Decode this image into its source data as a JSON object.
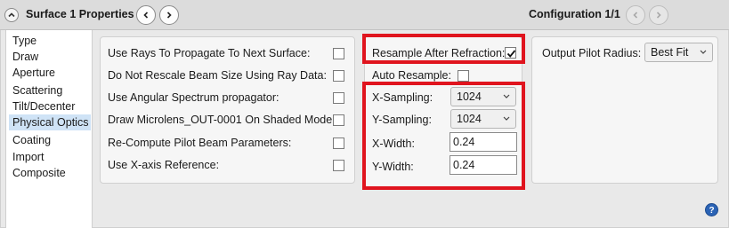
{
  "header": {
    "title": "Surface  1 Properties",
    "configuration": "Configuration 1/1"
  },
  "sidebar": {
    "items": [
      {
        "label": "Type"
      },
      {
        "label": "Draw"
      },
      {
        "label": "Aperture"
      },
      {
        "label": "Scattering"
      },
      {
        "label": "Tilt/Decenter"
      },
      {
        "label": "Physical Optics",
        "active": true
      },
      {
        "label": "Coating"
      },
      {
        "label": "Import"
      },
      {
        "label": "Composite"
      }
    ]
  },
  "options": {
    "items": [
      {
        "label": "Use Rays To Propagate To Next Surface:",
        "checked": false
      },
      {
        "label": "Do Not Rescale Beam Size Using Ray Data:",
        "checked": false
      },
      {
        "label": "Use Angular Spectrum propagator:",
        "checked": false
      },
      {
        "label": "Draw Microlens_OUT-0001 On Shaded Model:",
        "checked": false
      },
      {
        "label": "Re-Compute Pilot Beam Parameters:",
        "checked": false
      },
      {
        "label": "Use X-axis Reference:",
        "checked": false
      }
    ]
  },
  "resample": {
    "after_refraction_label": "Resample After Refraction:",
    "after_refraction_checked": true,
    "auto_label": "Auto Resample:",
    "auto_checked": false,
    "x_sampling_label": "X-Sampling:",
    "x_sampling_value": "1024",
    "y_sampling_label": "Y-Sampling:",
    "y_sampling_value": "1024",
    "x_width_label": "X-Width:",
    "x_width_value": "0.24",
    "y_width_label": "Y-Width:",
    "y_width_value": "0.24"
  },
  "pilot": {
    "label": "Output Pilot Radius:",
    "value": "Best Fit"
  },
  "icons": {
    "collapse": "chevron-up-icon",
    "prev": "chevron-left-icon",
    "next": "chevron-right-icon",
    "help": "help-icon"
  },
  "colors": {
    "highlight_border": "#e0141e",
    "active_sidebar": "#cfe3f6",
    "help": "#2b63b5"
  }
}
